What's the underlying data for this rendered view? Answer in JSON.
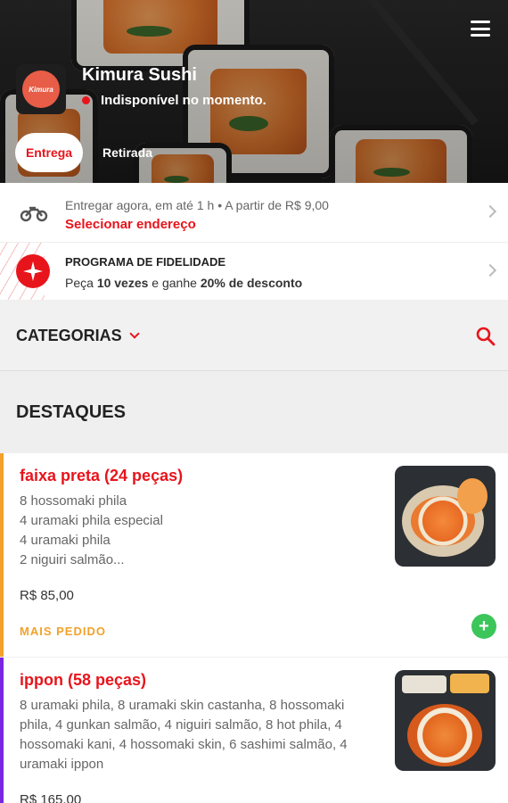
{
  "header": {
    "store_name": "Kimura Sushi",
    "status_text": "Indisponível no momento.",
    "logo_text": "Kimura",
    "tabs": [
      {
        "label": "Entrega",
        "active": true
      },
      {
        "label": "Retirada",
        "active": false
      }
    ]
  },
  "delivery": {
    "info_text": "Entregar agora, em até 1 h  •  A partir de R$ 9,00",
    "action_label": "Selecionar endereço"
  },
  "loyalty": {
    "title": "PROGRAMA DE FIDELIDADE",
    "desc_prefix": "Peça ",
    "desc_bold1": "10 vezes",
    "desc_middle": " e ganhe ",
    "desc_bold2": "20% de desconto"
  },
  "categories": {
    "label": "CATEGORIAS"
  },
  "section_title": "DESTAQUES",
  "products": [
    {
      "title": "faixa preta (24 peças)",
      "description_lines": [
        "8 hossomaki phila",
        "4 uramaki phila especial",
        "4 uramaki phila",
        "2 niguiri salmão..."
      ],
      "price": "R$ 85,00",
      "badge": "MAIS PEDIDO",
      "add_label": "+"
    },
    {
      "title": "ippon (58 peças)",
      "description": "8 uramaki phila, 8 uramaki skin castanha, 8 hossomaki phila, 4 gunkan salmão, 4 niguiri salmão, 8 hot phila, 4 hossomaki kani, 4 hossomaki skin, 6 sashimi salmão, 4 uramaki ippon",
      "price": "R$ 165,00"
    }
  ],
  "colors": {
    "accent": "#e8141c",
    "badge_orange": "#f3a12a",
    "add_green": "#3cc65a",
    "card2_border": "#7a26e0"
  },
  "icons": [
    "menu-icon",
    "motorcycle-icon",
    "star-badge-icon",
    "chevron-right-icon",
    "chevron-down-icon",
    "search-icon",
    "plus-icon"
  ]
}
